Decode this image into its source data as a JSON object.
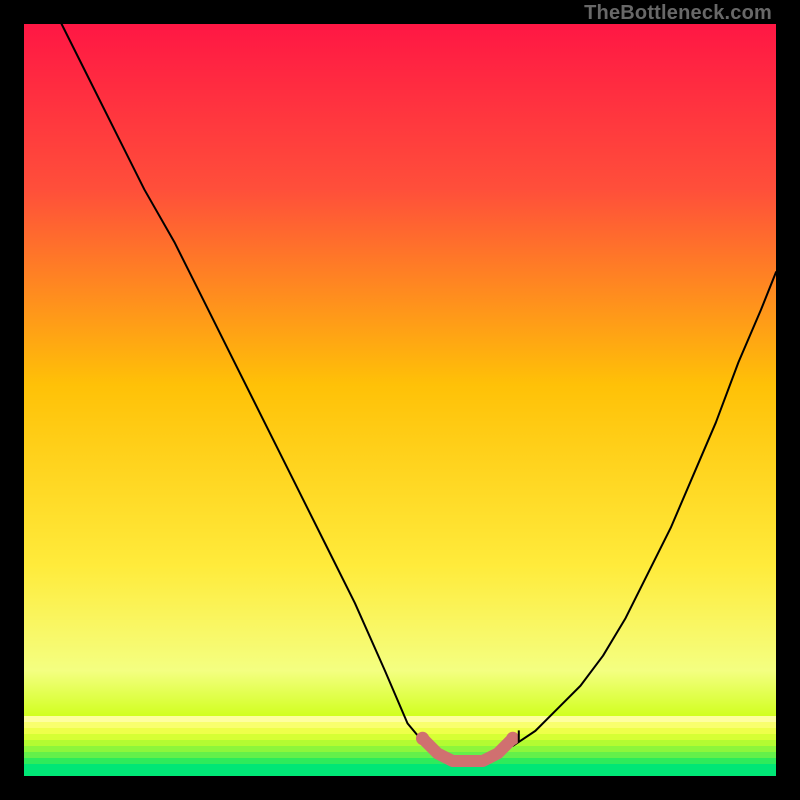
{
  "attribution": "TheBottleneck.com",
  "chart_data": {
    "type": "line",
    "title": "",
    "xlabel": "",
    "ylabel": "",
    "xlim": [
      0,
      100
    ],
    "ylim": [
      0,
      100
    ],
    "grid": false,
    "legend": false,
    "background_gradient": {
      "0.00": "#FF1744",
      "0.22": "#FF4F3A",
      "0.48": "#FFC107",
      "0.72": "#FFEB3B",
      "0.86": "#F4FF81",
      "0.94": "#C6FF00",
      "0.97": "#76FF03",
      "1.00": "#00E676"
    },
    "series": [
      {
        "name": "curve-left",
        "color": "#000000",
        "stroke_width": 2,
        "x": [
          5,
          8,
          12,
          16,
          20,
          24,
          28,
          32,
          36,
          40,
          44,
          48,
          51,
          53.5
        ],
        "y": [
          100,
          94,
          86,
          78,
          71,
          63,
          55,
          47,
          39,
          31,
          23,
          14,
          7,
          4
        ]
      },
      {
        "name": "curve-right",
        "color": "#000000",
        "stroke_width": 2,
        "x": [
          65,
          68,
          71,
          74,
          77,
          80,
          83,
          86,
          89,
          92,
          95,
          98,
          100
        ],
        "y": [
          4,
          6,
          9,
          12,
          16,
          21,
          27,
          33,
          40,
          47,
          55,
          62,
          67
        ]
      },
      {
        "name": "bottom-highlight",
        "color": "#D07070",
        "stroke_width": 12,
        "is_marker_style": "round-caps",
        "x": [
          53,
          55,
          57,
          59,
          61,
          63,
          65
        ],
        "y": [
          5,
          3,
          2,
          2,
          2,
          3,
          5
        ]
      }
    ],
    "bottom_stripes": [
      "#00E676",
      "#00E676",
      "#2EEB5B",
      "#64F04A",
      "#8DF63C",
      "#B4FB32",
      "#D6FF34",
      "#EEFF4A",
      "#F9FF6E",
      "#FEFFA0"
    ]
  }
}
